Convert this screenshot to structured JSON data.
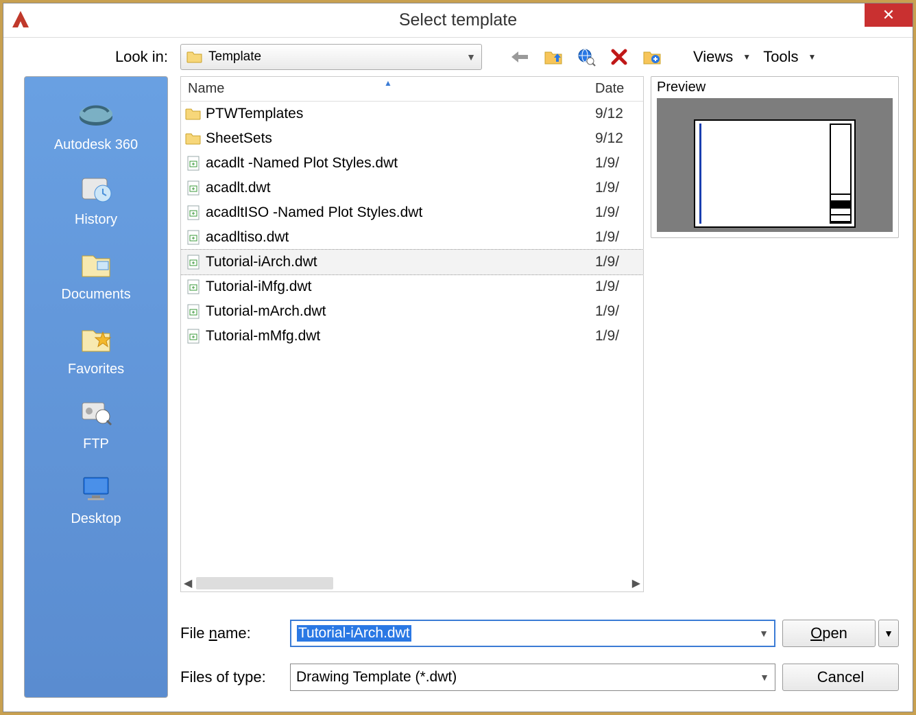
{
  "dialog": {
    "title": "Select template",
    "close_label": "✕"
  },
  "toolbar": {
    "lookin_label": "Look in:",
    "lookin_value": "Template",
    "views_label": "Views",
    "tools_label": "Tools"
  },
  "sidebar": {
    "items": [
      {
        "label": "Autodesk 360",
        "icon": "a360-icon"
      },
      {
        "label": "History",
        "icon": "history-icon"
      },
      {
        "label": "Documents",
        "icon": "documents-icon"
      },
      {
        "label": "Favorites",
        "icon": "favorites-icon"
      },
      {
        "label": "FTP",
        "icon": "ftp-icon"
      },
      {
        "label": "Desktop",
        "icon": "desktop-icon"
      }
    ]
  },
  "filelist": {
    "columns": {
      "name": "Name",
      "date": "Date"
    },
    "rows": [
      {
        "type": "folder",
        "name": "PTWTemplates",
        "date": "9/12"
      },
      {
        "type": "folder",
        "name": "SheetSets",
        "date": "9/12"
      },
      {
        "type": "dwt",
        "name": "acadlt -Named Plot Styles.dwt",
        "date": "1/9/"
      },
      {
        "type": "dwt",
        "name": "acadlt.dwt",
        "date": "1/9/"
      },
      {
        "type": "dwt",
        "name": "acadltISO -Named Plot Styles.dwt",
        "date": "1/9/"
      },
      {
        "type": "dwt",
        "name": "acadltiso.dwt",
        "date": "1/9/"
      },
      {
        "type": "dwt",
        "name": "Tutorial-iArch.dwt",
        "date": "1/9/",
        "selected": true
      },
      {
        "type": "dwt",
        "name": "Tutorial-iMfg.dwt",
        "date": "1/9/"
      },
      {
        "type": "dwt",
        "name": "Tutorial-mArch.dwt",
        "date": "1/9/"
      },
      {
        "type": "dwt",
        "name": "Tutorial-mMfg.dwt",
        "date": "1/9/"
      }
    ]
  },
  "preview": {
    "label": "Preview"
  },
  "form": {
    "filename_label": "File name:",
    "filename_value": "Tutorial-iArch.dwt",
    "filetype_label": "Files of type:",
    "filetype_value": "Drawing Template (*.dwt)",
    "open_label": "Open",
    "cancel_label": "Cancel"
  }
}
